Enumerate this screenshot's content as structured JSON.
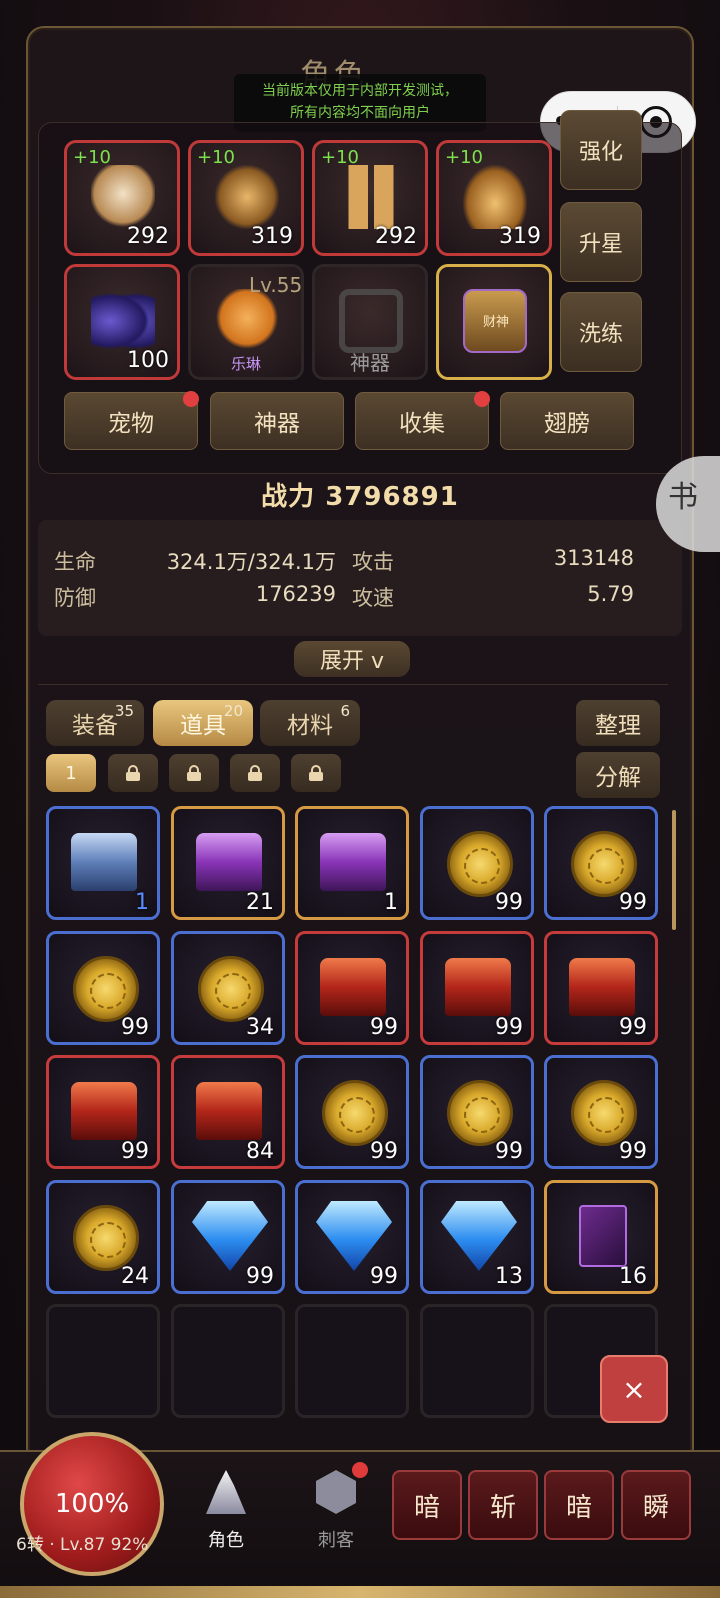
{
  "panel": {
    "title": "角色"
  },
  "notice": {
    "line1": "当前版本仅用于内部开发测试，",
    "line2": "所有内容均不面向用户"
  },
  "capsule": {
    "more_glyph": "•••"
  },
  "equipment": [
    {
      "plus": "+10",
      "num": "292",
      "art": "helm"
    },
    {
      "plus": "+10",
      "num": "319",
      "art": "armor"
    },
    {
      "plus": "+10",
      "num": "292",
      "art": "legs"
    },
    {
      "plus": "+10",
      "num": "319",
      "art": "boots"
    }
  ],
  "wings_slot": {
    "num": "100"
  },
  "pet_slot": {
    "level": "Lv.55",
    "name": "乐琳"
  },
  "relic_slot": {
    "label": "神器"
  },
  "title_slot": {
    "text": "财神"
  },
  "side_buttons": {
    "enhance": "强化",
    "star": "升星",
    "refine": "洗练"
  },
  "tabs": [
    {
      "label": "宠物",
      "dot": true
    },
    {
      "label": "神器",
      "dot": false
    },
    {
      "label": "收集",
      "dot": true
    },
    {
      "label": "翅膀",
      "dot": false
    }
  ],
  "power": "战力 3796891",
  "stats": {
    "hp_label": "生命",
    "hp_value": "324.1万/324.1万",
    "atk_label": "攻击",
    "atk_value": "313148",
    "def_label": "防御",
    "def_value": "176239",
    "spd_label": "攻速",
    "spd_value": "5.79"
  },
  "expand_label": "展开 v",
  "inventory_tabs": [
    {
      "label": "装备",
      "count": "35",
      "active": false
    },
    {
      "label": "道具",
      "count": "20",
      "active": true
    },
    {
      "label": "材料",
      "count": "6",
      "active": false
    }
  ],
  "tools": {
    "sort": "整理",
    "decompose": "分解"
  },
  "pages": {
    "current": "1"
  },
  "items": [
    {
      "icon": "chest-blue",
      "qty": "1",
      "quality": "blue",
      "qty_color": "blue"
    },
    {
      "icon": "chest-purple",
      "qty": "21",
      "quality": "orange"
    },
    {
      "icon": "chest-purple",
      "qty": "1",
      "quality": "orange"
    },
    {
      "icon": "coin",
      "qty": "99",
      "quality": "blue"
    },
    {
      "icon": "coin",
      "qty": "99",
      "quality": "blue"
    },
    {
      "icon": "coin",
      "qty": "99",
      "quality": "blue"
    },
    {
      "icon": "coin",
      "qty": "34",
      "quality": "blue"
    },
    {
      "icon": "chest-red",
      "qty": "99",
      "quality": "red"
    },
    {
      "icon": "chest-red",
      "qty": "99",
      "quality": "red"
    },
    {
      "icon": "chest-red",
      "qty": "99",
      "quality": "red"
    },
    {
      "icon": "chest-red",
      "qty": "99",
      "quality": "red"
    },
    {
      "icon": "chest-red",
      "qty": "84",
      "quality": "red"
    },
    {
      "icon": "coin",
      "qty": "99",
      "quality": "blue"
    },
    {
      "icon": "coin",
      "qty": "99",
      "quality": "blue"
    },
    {
      "icon": "coin",
      "qty": "99",
      "quality": "blue"
    },
    {
      "icon": "coin",
      "qty": "24",
      "quality": "blue"
    },
    {
      "icon": "gem",
      "qty": "99",
      "quality": "blue"
    },
    {
      "icon": "gem",
      "qty": "99",
      "quality": "blue"
    },
    {
      "icon": "gem",
      "qty": "13",
      "quality": "blue"
    },
    {
      "icon": "book",
      "qty": "16",
      "quality": "orange"
    }
  ],
  "close_label": "×",
  "bottom": {
    "hp_percent": "100%",
    "info": "6转 · Lv.87  92%",
    "nav_role": "角色",
    "nav_class": "刺客",
    "skills": [
      "暗",
      "斩",
      "暗",
      "瞬"
    ]
  },
  "side_seal": "书"
}
